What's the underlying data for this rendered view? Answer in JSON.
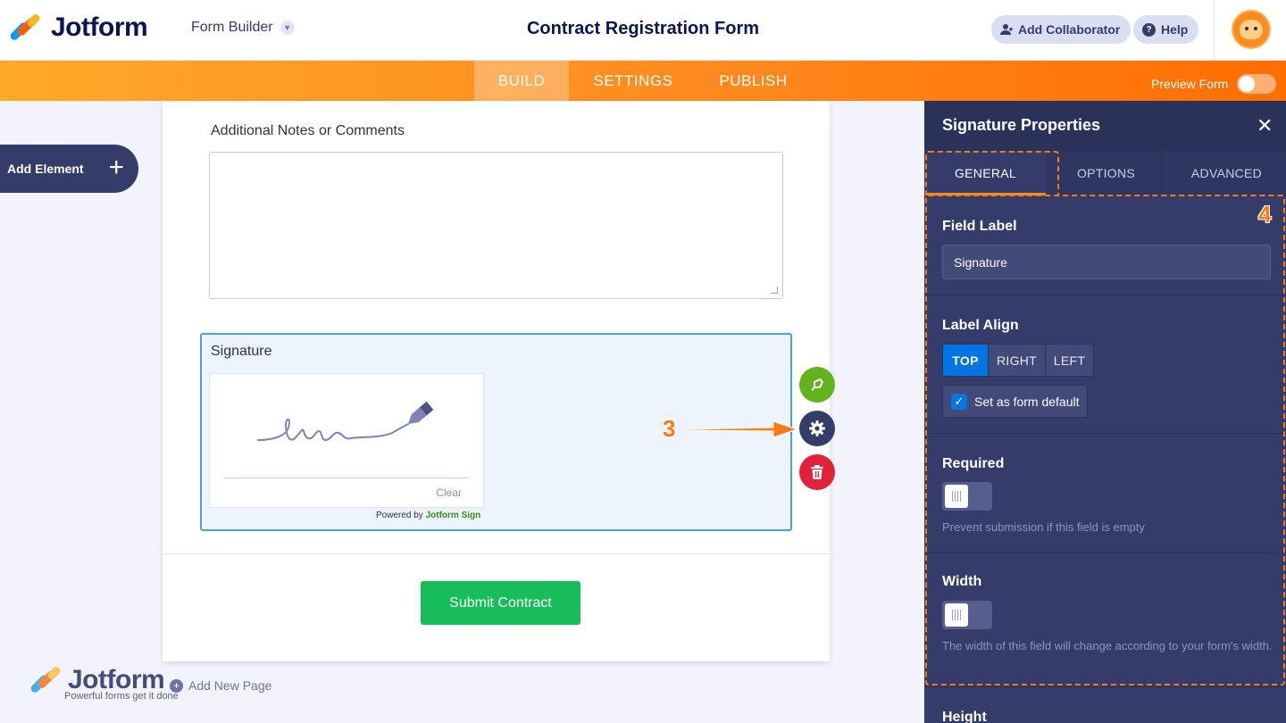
{
  "header": {
    "logo_text": "Jotform",
    "form_builder_label": "Form Builder",
    "form_title": "Contract Registration Form",
    "add_collaborator_label": "Add Collaborator",
    "help_label": "Help"
  },
  "nav": {
    "tabs": [
      {
        "label": "BUILD",
        "active": true
      },
      {
        "label": "SETTINGS",
        "active": false
      },
      {
        "label": "PUBLISH",
        "active": false
      }
    ],
    "preview_label": "Preview Form",
    "preview_on": false
  },
  "sidebar": {
    "add_element_label": "Add Element"
  },
  "form": {
    "notes_label": "Additional Notes or Comments",
    "notes_value": "",
    "signature_label": "Signature",
    "clear_label": "Clear",
    "powered_prefix": "Powered by",
    "powered_brand": "Jotform Sign",
    "submit_label": "Submit Contract"
  },
  "annotations": {
    "step3": "3",
    "step4": "4"
  },
  "footer": {
    "logo_text": "Jotform",
    "tagline": "Powerful forms get it done",
    "add_page_label": "Add New Page"
  },
  "panel": {
    "title": "Signature Properties",
    "tabs": [
      {
        "label": "GENERAL",
        "active": true
      },
      {
        "label": "OPTIONS",
        "active": false
      },
      {
        "label": "ADVANCED",
        "active": false
      }
    ],
    "field_label_title": "Field Label",
    "field_label_value": "Signature",
    "label_align_title": "Label Align",
    "align_options": [
      {
        "label": "TOP",
        "active": true
      },
      {
        "label": "RIGHT",
        "active": false
      },
      {
        "label": "LEFT",
        "active": false
      }
    ],
    "default_checkbox_label": "Set as form default",
    "default_checked": true,
    "required_title": "Required",
    "required_on": false,
    "required_help": "Prevent submission if this field is empty",
    "width_title": "Width",
    "width_on": false,
    "width_help": "The width of this field will change according to your form's width.",
    "height_title": "Height"
  },
  "colors": {
    "accent_orange": "#ff8a1f",
    "brand_navy": "#0a1551",
    "panel_bg": "#343c6a",
    "submit_green": "#18bd5b",
    "active_blue": "#0075e3"
  }
}
